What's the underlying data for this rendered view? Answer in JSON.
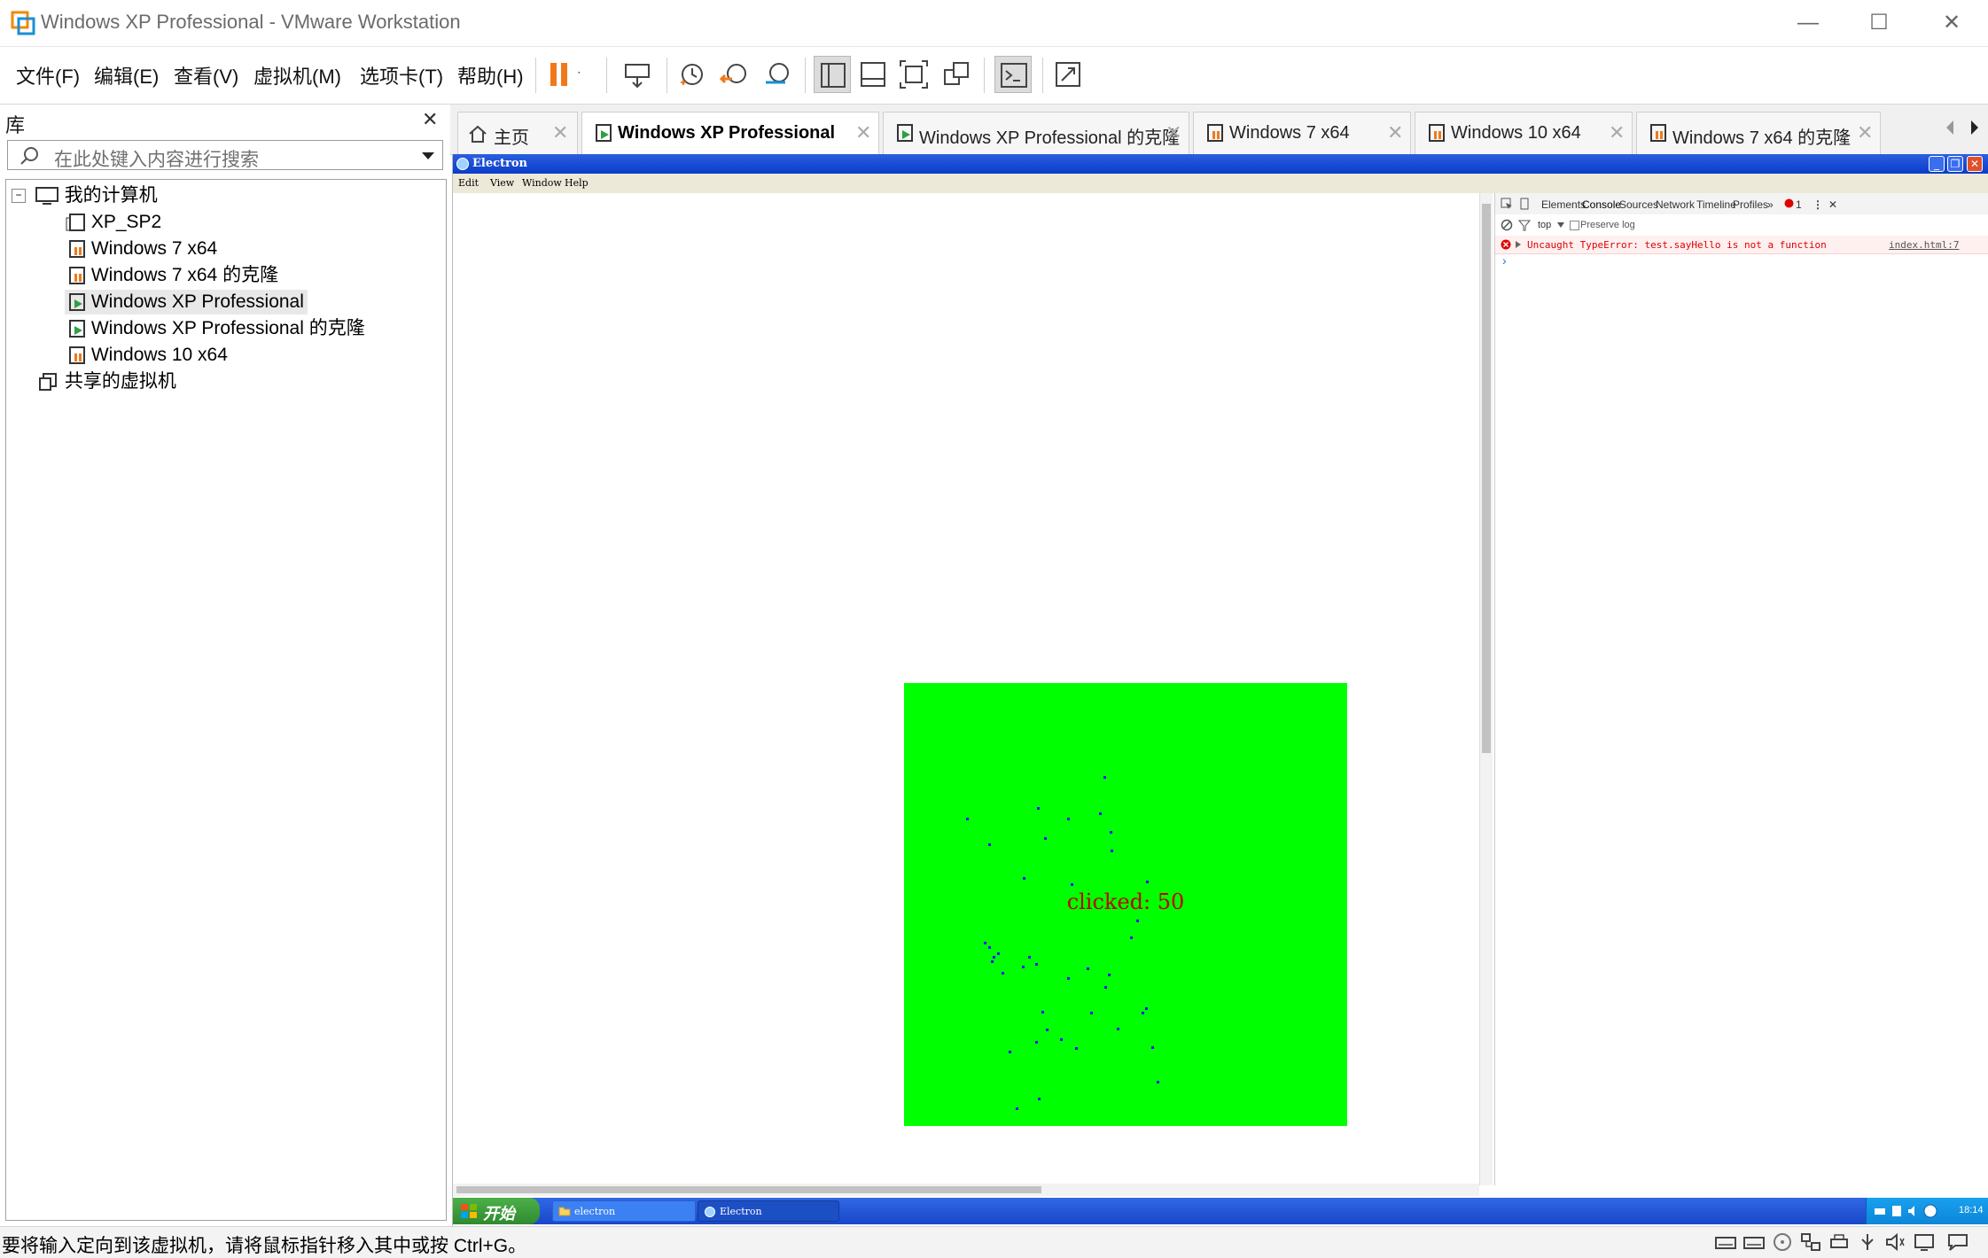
{
  "window": {
    "title": "Windows XP Professional - VMware Workstation",
    "controls": [
      "—",
      "☐",
      "✕"
    ]
  },
  "menu": {
    "items": [
      "文件(F)",
      "编辑(E)",
      "查看(V)",
      "虚拟机(M)",
      "选项卡(T)",
      "帮助(H)"
    ]
  },
  "library": {
    "title": "库",
    "close": "✕",
    "search_placeholder": "在此处键入内容进行搜索",
    "root": "我的计算机",
    "vms": [
      "XP_SP2",
      "Windows 7 x64",
      "Windows 7 x64 的克隆",
      "Windows XP Professional",
      "Windows XP Professional 的克隆",
      "Windows 10 x64"
    ],
    "selected": "Windows XP Professional",
    "shared": "共享的虚拟机"
  },
  "tabs": [
    {
      "label": "主页"
    },
    {
      "label": "Windows XP Professional"
    },
    {
      "label": "Windows XP Professional 的克隆"
    },
    {
      "label": "Windows 7 x64"
    },
    {
      "label": "Windows 10 x64"
    },
    {
      "label": "Windows 7 x64 的克隆"
    }
  ],
  "tab_close": "✕",
  "guest": {
    "app_title": "Electron",
    "app_menu": [
      "Edit",
      "View",
      "Window",
      "Help"
    ],
    "canvas_text": "clicked: 50",
    "canvas_color": "#00ff00",
    "dot_color": "#1010ff",
    "devtools": {
      "tabs": [
        "Elements",
        "Console",
        "Sources",
        "Network",
        "Timeline",
        "Profiles"
      ],
      "more": "»",
      "active_tab": "Console",
      "error_count": "1",
      "context": "top",
      "preserve_log": "Preserve log",
      "error_message": "Uncaught TypeError: test.sayHello is not a function",
      "error_source": "index.html:7",
      "prompt": "›"
    },
    "taskbar": {
      "start": "开始",
      "items": [
        "electron",
        "Electron"
      ],
      "clock": "18:14"
    }
  },
  "status": {
    "text": "要将输入定向到该虚拟机，请将鼠标指针移入其中或按 Ctrl+G。"
  }
}
